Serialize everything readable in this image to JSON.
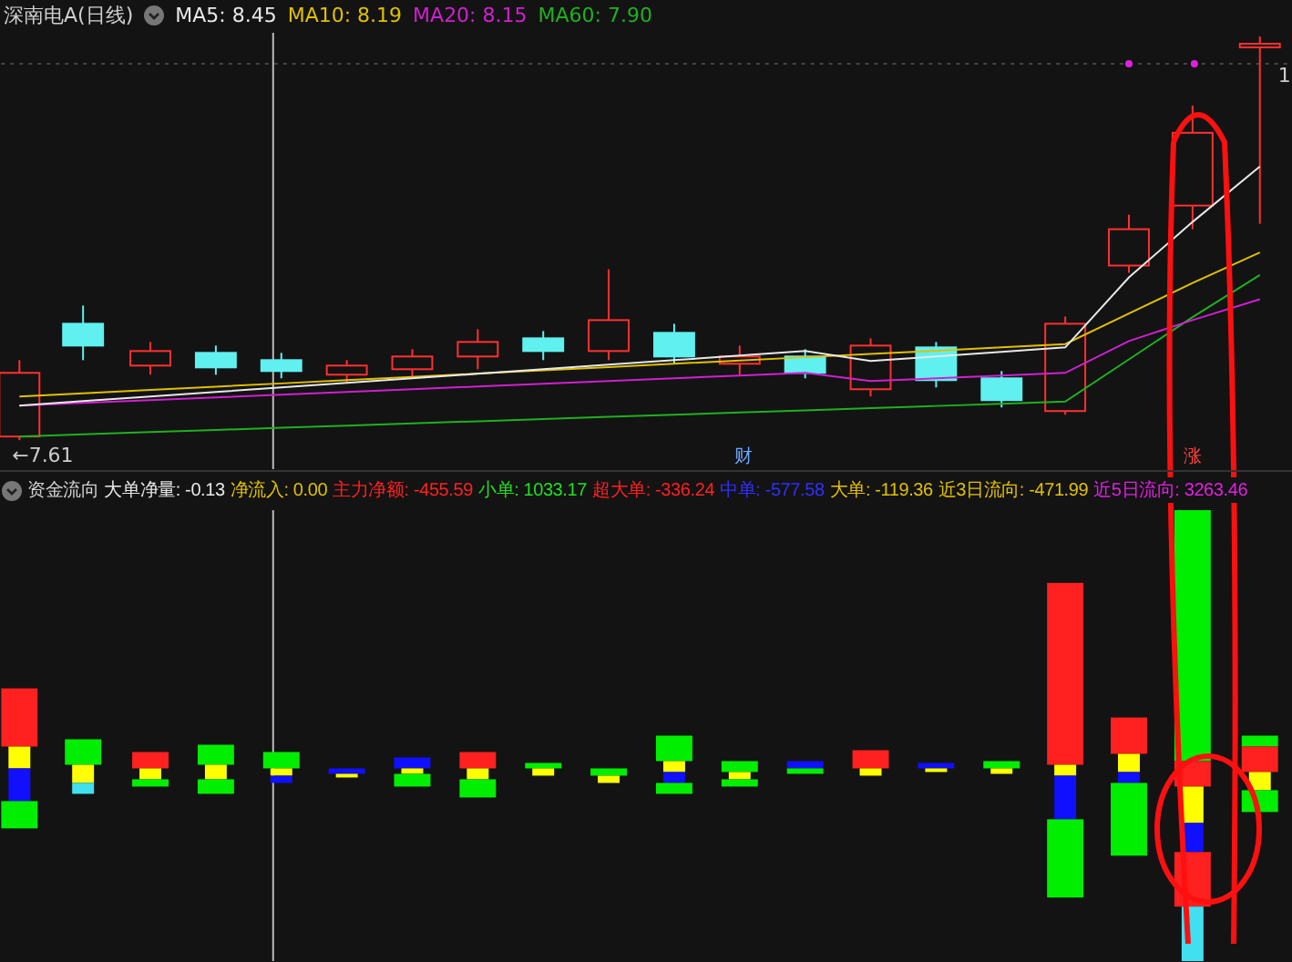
{
  "title": "深南电A(日线)",
  "ma_legend": [
    {
      "label": "MA5: 8.45",
      "color": "#e8e8e8"
    },
    {
      "label": "MA10: 8.19",
      "color": "#e0c000"
    },
    {
      "label": "MA20: 8.15",
      "color": "#d020d0"
    },
    {
      "label": "MA60: 7.90",
      "color": "#20b020"
    }
  ],
  "price_labels": {
    "low": "←7.61",
    "high": "1"
  },
  "markers": [
    {
      "text": "财",
      "color": "#6fa8ff"
    },
    {
      "text": "涨",
      "color": "#ff4040"
    }
  ],
  "indicator": {
    "name": "资金流向",
    "items": [
      {
        "label": "大单净量: -0.13",
        "color": "#e8e8e8"
      },
      {
        "label": "净流入: 0.00",
        "color": "#e0c000"
      },
      {
        "label": "主力净额: -455.59",
        "color": "#ff2020"
      },
      {
        "label": "小单: 1033.17",
        "color": "#20e020"
      },
      {
        "label": "超大单: -336.24",
        "color": "#ff2020"
      },
      {
        "label": "中单: -577.58",
        "color": "#3030ff"
      },
      {
        "label": "大单: -119.36",
        "color": "#e0c000"
      },
      {
        "label": "近3日流向: -471.99",
        "color": "#e0c000"
      },
      {
        "label": "近5日流向: 3263.46",
        "color": "#e020e0"
      }
    ]
  }
}
